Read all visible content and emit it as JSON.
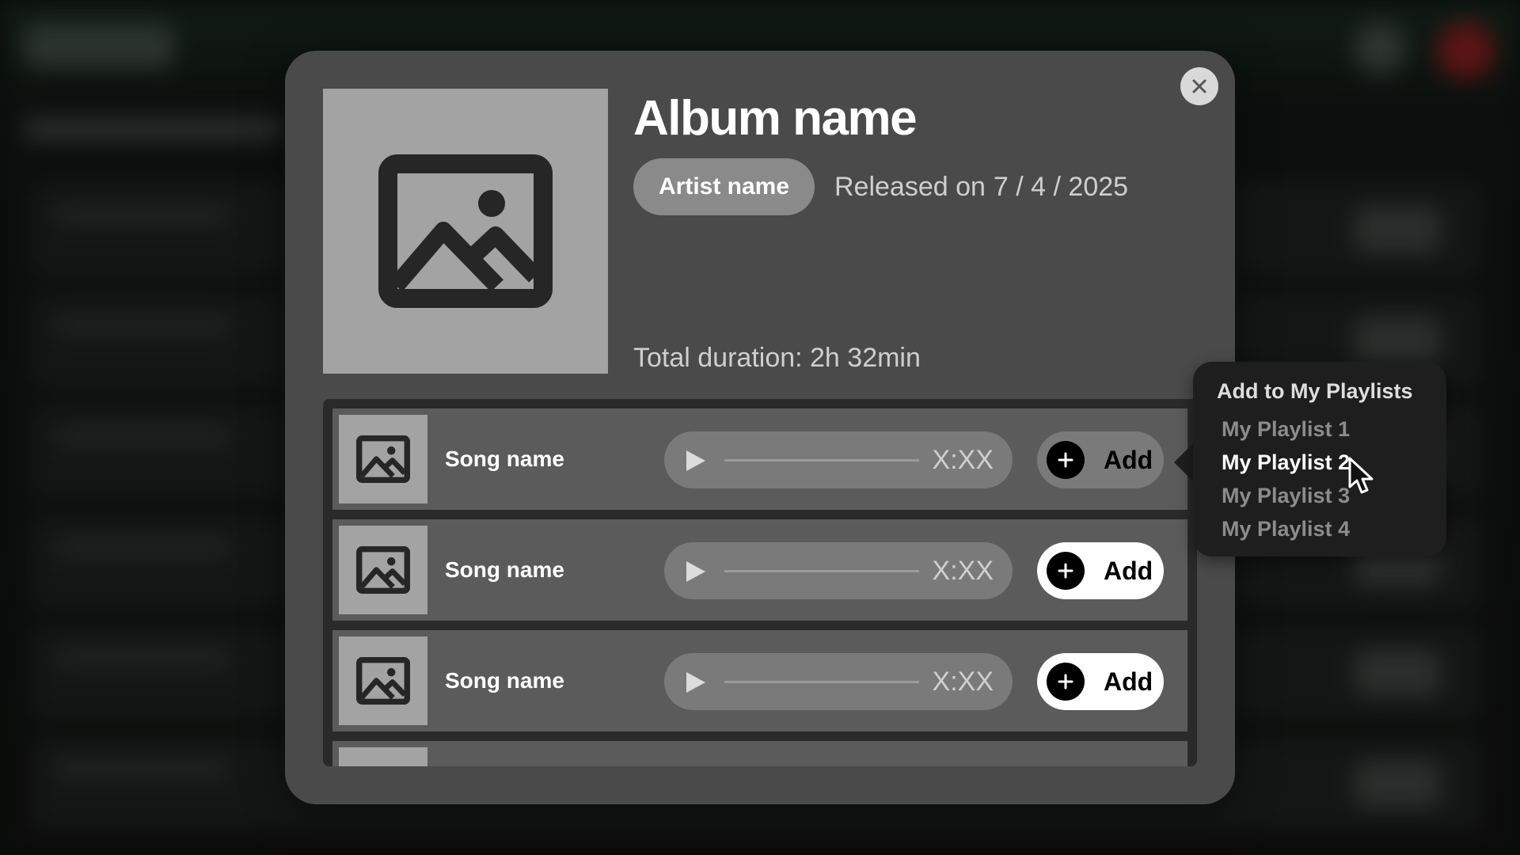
{
  "album": {
    "title": "Album name",
    "artist": "Artist name",
    "release_label": "Released on",
    "release_date": "7 / 4 / 2025",
    "total_duration": "Total duration: 2h 32min"
  },
  "songs": [
    {
      "name": "Song name",
      "duration": "X:XX",
      "add_label": "Add",
      "state": "active"
    },
    {
      "name": "Song name",
      "duration": "X:XX",
      "add_label": "Add",
      "state": "normal"
    },
    {
      "name": "Song name",
      "duration": "X:XX",
      "add_label": "Add",
      "state": "normal"
    }
  ],
  "popover": {
    "title": "Add to My Playlists",
    "items": [
      "My Playlist 1",
      "My Playlist 2",
      "My Playlist 3",
      "My Playlist 4"
    ],
    "hovered": "My Playlist 2"
  },
  "icons": {
    "close": "close-icon",
    "cover": "image-placeholder-icon",
    "play": "play-icon",
    "add": "plus-circle-icon",
    "cursor": "mouse-pointer-icon"
  },
  "colors": {
    "modal_bg": "#4a4a4a",
    "row_bg": "#5b5b5b",
    "placeholder": "#a3a3a3",
    "pill": "#8a8a8a",
    "popover_bg": "#1e1e1e"
  }
}
